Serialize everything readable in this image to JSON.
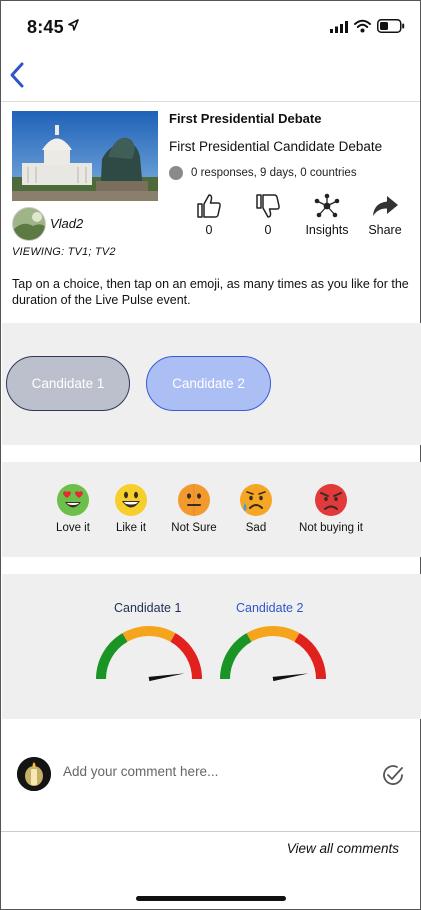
{
  "status_bar": {
    "time": "8:45"
  },
  "event": {
    "title": "First Presidential Debate",
    "subtitle": "First Presidential Candidate Debate",
    "stats": "0 responses, 9 days, 0 countries"
  },
  "actions": {
    "like_count": "0",
    "dislike_count": "0",
    "insights_label": "Insights",
    "share_label": "Share"
  },
  "author": {
    "username": "Vlad2"
  },
  "viewing": "VIEWING: TV1; TV2",
  "instructions": "Tap on a choice, then tap on an emoji, as many times as you like for the duration of the Live Pulse event.",
  "choices": [
    {
      "label": "Candidate 1",
      "selected": false
    },
    {
      "label": "Candidate 2",
      "selected": true
    }
  ],
  "emojis": [
    {
      "label": "Love it",
      "icon": "heart-eyes-emoji-icon"
    },
    {
      "label": "Like it",
      "icon": "grinning-emoji-icon"
    },
    {
      "label": "Not Sure",
      "icon": "neutral-emoji-icon"
    },
    {
      "label": "Sad",
      "icon": "sad-emoji-icon"
    },
    {
      "label": "Not buying it",
      "icon": "angry-emoji-icon"
    }
  ],
  "gauges": [
    {
      "label": "Candidate 1",
      "color": "#1f2e55",
      "value": 0.95
    },
    {
      "label": "Candidate 2",
      "color": "#2f56c9",
      "value": 0.95
    }
  ],
  "comment": {
    "placeholder": "Add your comment here...",
    "value": ""
  },
  "view_all_comments": "View all comments",
  "colors": {
    "accent_blue": "#2f56c9",
    "gauge_green": "#1a9424",
    "gauge_orange": "#f5a51c",
    "gauge_red": "#e0211d",
    "panel_gray": "#efefef"
  }
}
